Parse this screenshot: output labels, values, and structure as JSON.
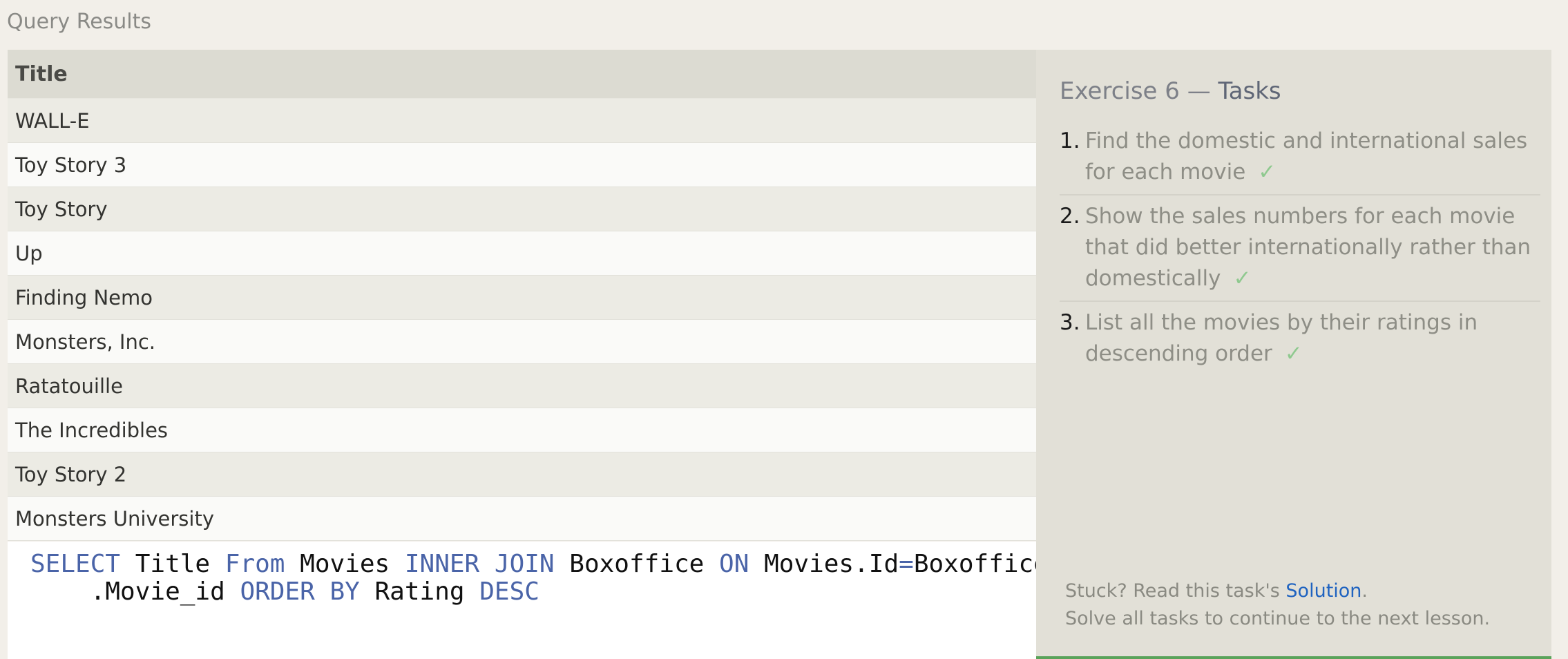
{
  "query_results": {
    "label": "Query Results",
    "column_header": "Title",
    "rows": [
      "WALL-E",
      "Toy Story 3",
      "Toy Story",
      "Up",
      "Finding Nemo",
      "Monsters, Inc.",
      "Ratatouille",
      "The Incredibles",
      "Toy Story 2",
      "Monsters University"
    ]
  },
  "editor": {
    "tokens": [
      {
        "text": "SELECT",
        "kind": "keyword"
      },
      {
        "text": " Title ",
        "kind": "plain"
      },
      {
        "text": "From",
        "kind": "keyword"
      },
      {
        "text": " Movies ",
        "kind": "plain"
      },
      {
        "text": "INNER JOIN",
        "kind": "keyword"
      },
      {
        "text": " Boxoffice ",
        "kind": "plain"
      },
      {
        "text": "ON",
        "kind": "keyword"
      },
      {
        "text": " Movies.Id",
        "kind": "plain"
      },
      {
        "text": "=",
        "kind": "keyword"
      },
      {
        "text": "Boxoffice\n    .Movie_id ",
        "kind": "plain"
      },
      {
        "text": "ORDER BY",
        "kind": "keyword"
      },
      {
        "text": " Rating ",
        "kind": "plain"
      },
      {
        "text": "DESC",
        "kind": "keyword"
      }
    ]
  },
  "tasks": {
    "title_prefix": "Exercise 6 — ",
    "title_accent": "Tasks",
    "items": [
      {
        "number": "1.",
        "text": "Find the domestic and international sales for each movie",
        "check": "✓"
      },
      {
        "number": "2.",
        "text": "Show the sales numbers for each movie that did better internationally rather than domestically",
        "check": "✓"
      },
      {
        "number": "3.",
        "text": "List all the movies by their ratings in descending order",
        "check": "✓"
      }
    ],
    "help_prefix": "Stuck? Read this task's ",
    "help_link": "Solution",
    "help_suffix": ".",
    "help_line2": "Solve all tasks to continue to the next lesson."
  },
  "colors": {
    "keyword": "#4a64a8",
    "check": "#8fc98f",
    "link": "#1f63c0",
    "progress_bar": "#5aa35a"
  }
}
